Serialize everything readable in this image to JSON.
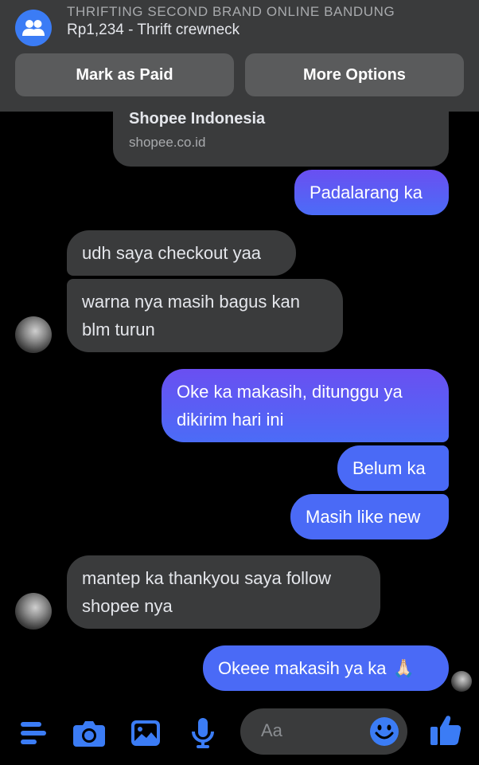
{
  "banner": {
    "title": "THRIFTING SECOND BRAND ONLINE BANDUNG",
    "subtitle": "Rp1,234 - Thrift crewneck",
    "mark_paid": "Mark as Paid",
    "more_options": "More Options",
    "icon": "group-icon"
  },
  "link_preview": {
    "title": "Shopee Indonesia",
    "url": "shopee.co.id"
  },
  "messages": [
    {
      "side": "out",
      "text": "Padalarang ka"
    },
    {
      "side": "in",
      "text": "udh saya checkout yaa"
    },
    {
      "side": "in",
      "line1": "warna nya masih bagus kan",
      "line2": "blm turun"
    },
    {
      "side": "out",
      "line1": "Oke ka makasih, ditunggu ya",
      "line2": "dikirim hari ini"
    },
    {
      "side": "out",
      "text": "Belum ka"
    },
    {
      "side": "out",
      "text": "Masih like new"
    },
    {
      "side": "in",
      "line1": "mantep ka thankyou saya follow",
      "line2": "shopee nya"
    },
    {
      "side": "out",
      "text": "Okeee makasih ya ka",
      "emoji": "🙏🏻"
    }
  ],
  "composer": {
    "placeholder": "Aa",
    "icons": [
      "menu-icon",
      "camera-icon",
      "photo-icon",
      "mic-icon",
      "emoji-icon",
      "thumbs-up-icon"
    ]
  },
  "colors": {
    "accent": "#3b7cf5",
    "incoming_bubble": "#3a3b3c",
    "outgoing_top": "#6a4ff1",
    "outgoing_bottom": "#4a6af6"
  }
}
